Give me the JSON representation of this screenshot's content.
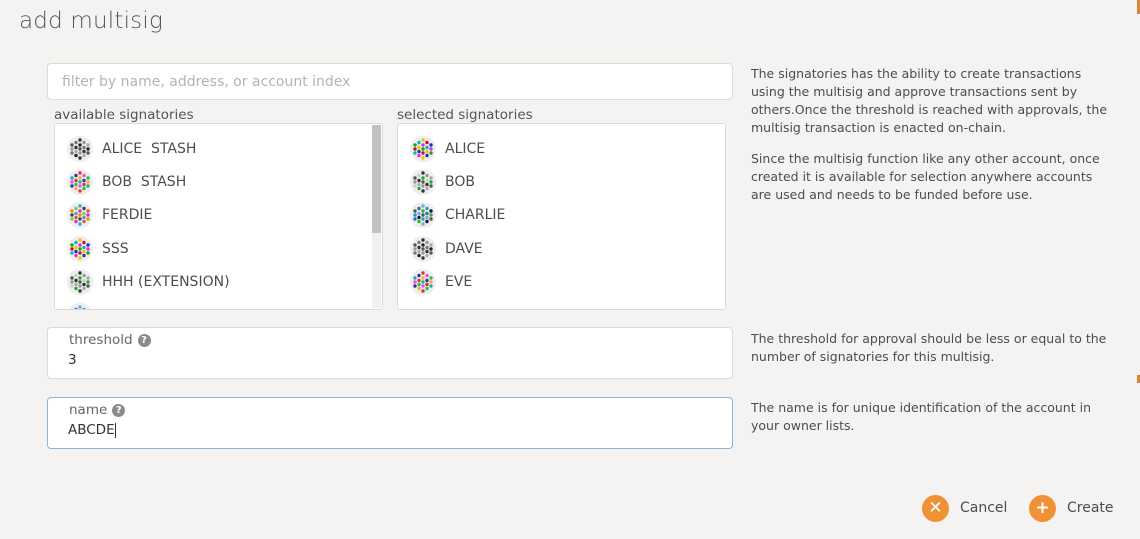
{
  "modal": {
    "title": "add multisig"
  },
  "filter": {
    "placeholder": "filter by name, address, or account index"
  },
  "available": {
    "label": "available signatories",
    "items": [
      "ALICE  STASH",
      "BOB  STASH",
      "FERDIE",
      "SSS",
      "HHH (EXTENSION)",
      ""
    ]
  },
  "selected": {
    "label": "selected signatories",
    "items": [
      "ALICE",
      "BOB",
      "CHARLIE",
      "DAVE",
      "EVE"
    ]
  },
  "help": {
    "signatories_1": "The signatories has the ability to create transactions using the multisig and approve transactions sent by others.Once the threshold is reached with approvals, the multisig transaction is enacted on-chain.",
    "signatories_2": "Since the multisig function like any other account, once created it is available for selection anywhere accounts are used and needs to be funded before use.",
    "threshold": "The threshold for approval should be less or equal to the number of signatories for this multisig.",
    "name": "The name is for unique identification of the account in your owner lists."
  },
  "threshold": {
    "label": "threshold",
    "value": "3"
  },
  "name": {
    "label": "name",
    "value": "ABCDE"
  },
  "buttons": {
    "cancel": "Cancel",
    "create": "Create"
  },
  "icons": {
    "help": "question-circle-icon",
    "cancel": "close-circle-icon",
    "create": "plus-circle-icon",
    "identicon": "identicon-icon"
  },
  "colors": {
    "accent": "#f19135",
    "focus_border": "#8fb4d9"
  }
}
